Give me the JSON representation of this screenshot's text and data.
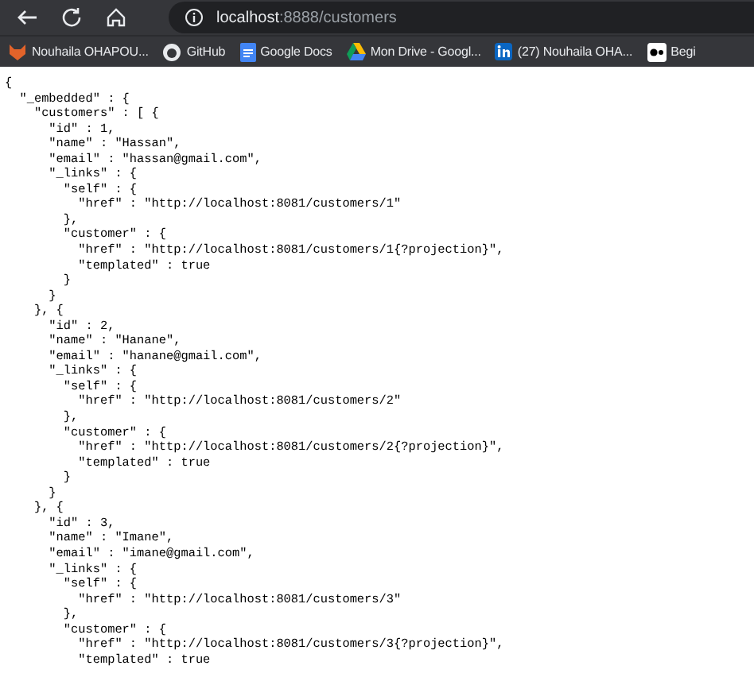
{
  "toolbar": {
    "address": {
      "host": "localhost",
      "path": ":8888/customers"
    }
  },
  "bookmarks": [
    {
      "label": "Nouhaila OHAPOU...",
      "kind": "fox"
    },
    {
      "label": "GitHub",
      "kind": "cat"
    },
    {
      "label": "Google Docs",
      "kind": "doc"
    },
    {
      "label": "Mon Drive - Googl...",
      "kind": "drive"
    },
    {
      "label": "(27) Nouhaila OHA...",
      "kind": "in"
    },
    {
      "label": "Begi",
      "kind": "dots"
    }
  ],
  "json_lines": [
    "{",
    "  \"_embedded\" : {",
    "    \"customers\" : [ {",
    "      \"id\" : 1,",
    "      \"name\" : \"Hassan\",",
    "      \"email\" : \"hassan@gmail.com\",",
    "      \"_links\" : {",
    "        \"self\" : {",
    "          \"href\" : \"http://localhost:8081/customers/1\"",
    "        },",
    "        \"customer\" : {",
    "          \"href\" : \"http://localhost:8081/customers/1{?projection}\",",
    "          \"templated\" : true",
    "        }",
    "      }",
    "    }, {",
    "      \"id\" : 2,",
    "      \"name\" : \"Hanane\",",
    "      \"email\" : \"hanane@gmail.com\",",
    "      \"_links\" : {",
    "        \"self\" : {",
    "          \"href\" : \"http://localhost:8081/customers/2\"",
    "        },",
    "        \"customer\" : {",
    "          \"href\" : \"http://localhost:8081/customers/2{?projection}\",",
    "          \"templated\" : true",
    "        }",
    "      }",
    "    }, {",
    "      \"id\" : 3,",
    "      \"name\" : \"Imane\",",
    "      \"email\" : \"imane@gmail.com\",",
    "      \"_links\" : {",
    "        \"self\" : {",
    "          \"href\" : \"http://localhost:8081/customers/3\"",
    "        },",
    "        \"customer\" : {",
    "          \"href\" : \"http://localhost:8081/customers/3{?projection}\",",
    "          \"templated\" : true"
  ]
}
